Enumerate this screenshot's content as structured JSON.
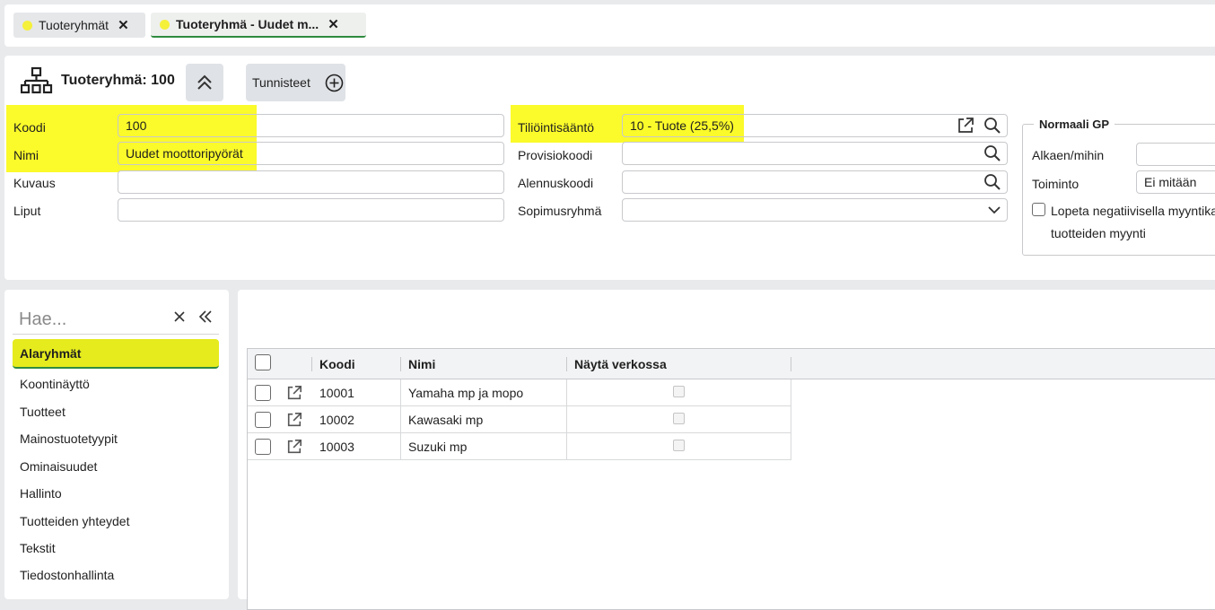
{
  "tabs": [
    {
      "label": "Tuoteryhmät",
      "active": false
    },
    {
      "label": "Tuoteryhmä - Uudet m...",
      "active": true
    }
  ],
  "header": {
    "title": "Tuoteryhmä: 100",
    "tags_label": "Tunnisteet"
  },
  "form_left": {
    "koodi_label": "Koodi",
    "koodi_value": "100",
    "nimi_label": "Nimi",
    "nimi_value": "Uudet moottoripyörät",
    "kuvaus_label": "Kuvaus",
    "kuvaus_value": "",
    "liput_label": "Liput",
    "liput_value": ""
  },
  "form_mid": {
    "tiliointi_label": "Tiliöintisääntö",
    "tiliointi_value": "10 - Tuote (25,5%)",
    "provisio_label": "Provisiokoodi",
    "provisio_value": "",
    "alennus_label": "Alennuskoodi",
    "alennus_value": "",
    "sopimus_label": "Sopimusryhmä",
    "sopimus_value": ""
  },
  "gp": {
    "legend": "Normaali GP",
    "alkaen_label": "Alkaen/mihin",
    "toiminto_label": "Toiminto",
    "toiminto_value": "Ei mitään",
    "checkbox_line1": "Lopeta negatiivisella myyntika",
    "checkbox_line2": "tuotteiden myynti"
  },
  "sidebar": {
    "search_placeholder": "Hae...",
    "items": [
      {
        "label": "Alaryhmät",
        "selected": true
      },
      {
        "label": "Koontinäyttö"
      },
      {
        "label": "Tuotteet"
      },
      {
        "label": "Mainostuotetyypit"
      },
      {
        "label": "Ominaisuudet"
      },
      {
        "label": "Hallinto"
      },
      {
        "label": "Tuotteiden yhteydet"
      },
      {
        "label": "Tekstit"
      },
      {
        "label": "Tiedostonhallinta"
      }
    ]
  },
  "grid": {
    "columns": [
      "Koodi",
      "Nimi",
      "Näytä verkossa"
    ],
    "rows": [
      {
        "koodi": "10001",
        "nimi": "Yamaha mp ja mopo"
      },
      {
        "koodi": "10002",
        "nimi": "Kawasaki mp"
      },
      {
        "koodi": "10003",
        "nimi": "Suzuki mp"
      }
    ]
  },
  "colors": {
    "highlight": "#fbfa2a",
    "accent_green": "#2e8b3e",
    "tab_dot": "#f5f03a"
  }
}
